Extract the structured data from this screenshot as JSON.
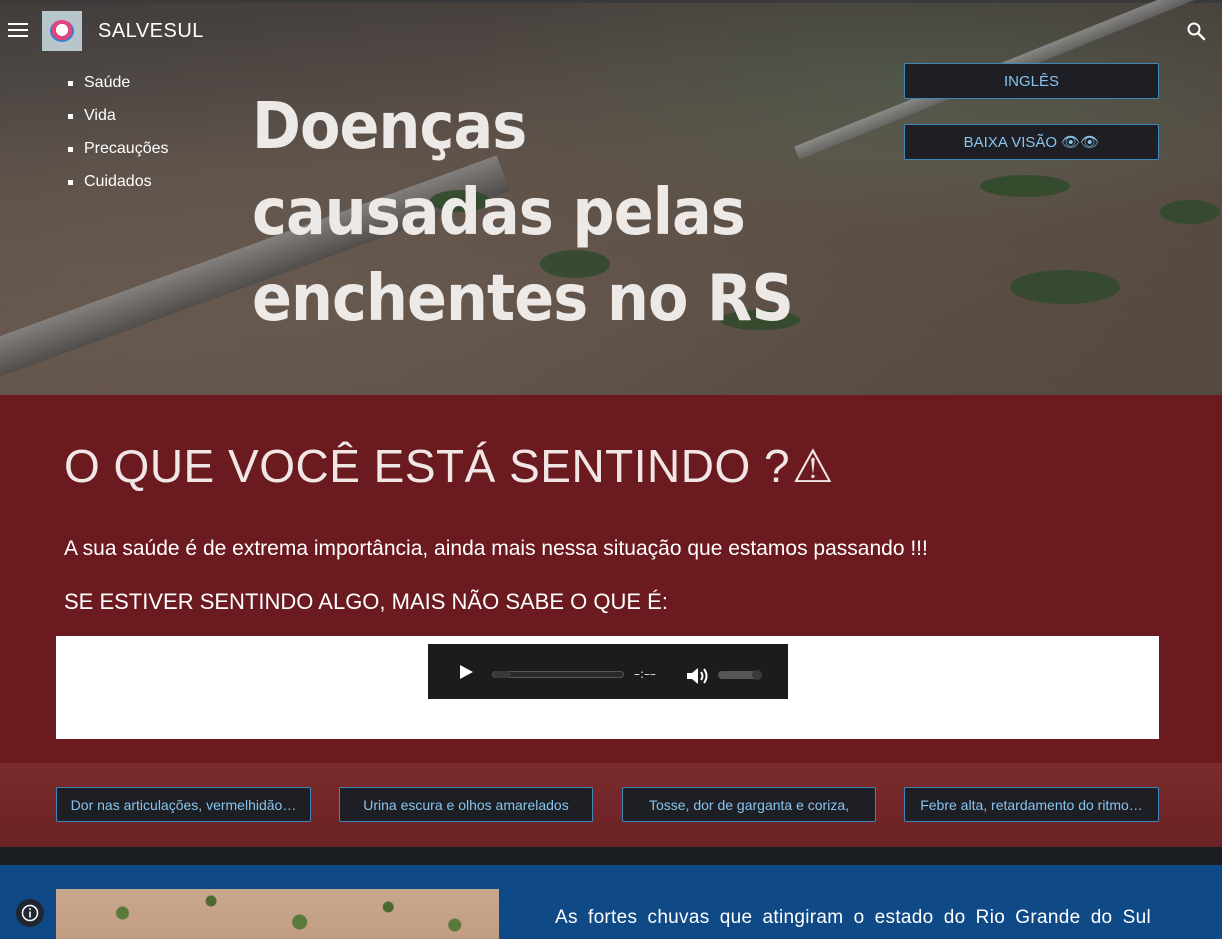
{
  "header": {
    "site_title": "SALVESUL",
    "nav_items": [
      "Saúde",
      "Vida",
      "Precauções",
      "Cuidados"
    ],
    "icons": {
      "menu": "menu-icon",
      "logo": "heart-logo",
      "search": "search-icon"
    }
  },
  "hero": {
    "title": "Doenças causadas pelas enchentes no RS",
    "english_button": "INGLÊS",
    "low_vision_button": "BAIXA VISÃO 👁👁"
  },
  "feeling_section": {
    "title": "O QUE VOCÊ ESTÁ SENTINDO ?",
    "title_icon": "⚠",
    "paragraph_1": "A sua saúde é de extrema importância, ainda mais nessa situação que estamos passando !!!",
    "paragraph_2": "SE ESTIVER SENTINDO ALGO, MAIS NÃO SABE O QUE É:",
    "audio": {
      "time": "–:––",
      "progress": 0,
      "volume": 1
    }
  },
  "symptoms": [
    "Dor nas articulações, vermelhidão…",
    "Urina escura e olhos amarelados",
    "Tosse, dor de garganta e coriza,",
    "Febre alta, retardamento do ritmo…"
  ],
  "info_section": {
    "text": "As fortes chuvas que atingiram o estado do Rio Grande do Sul"
  },
  "colors": {
    "red_section": "#6b1a1f",
    "button_bg": "#1e1f24",
    "button_text": "#88c4ec",
    "blue_section": "#0f4a86"
  }
}
